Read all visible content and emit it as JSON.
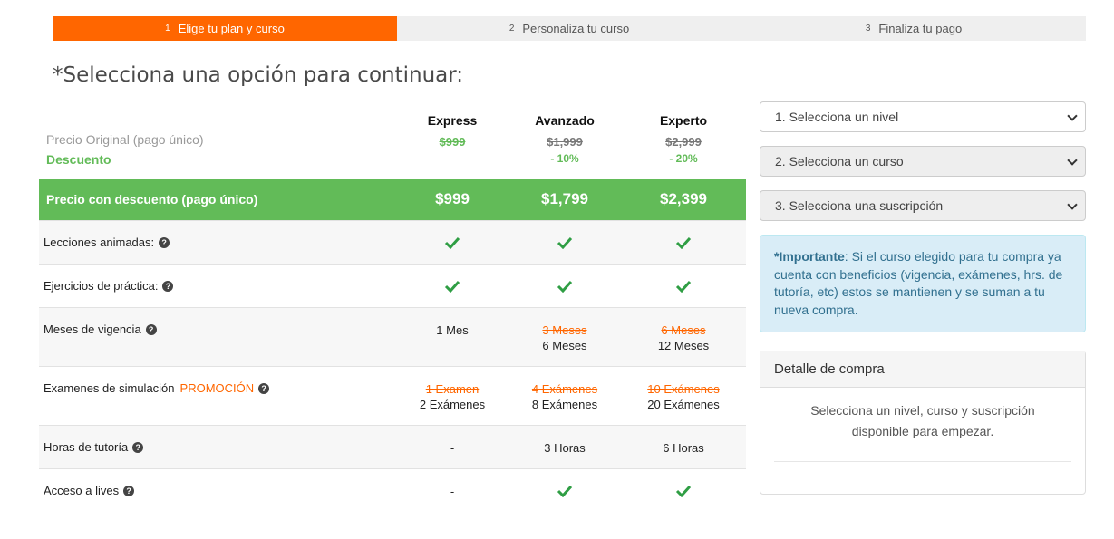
{
  "stepper": [
    {
      "num": "1",
      "label": "Elige tu plan y curso"
    },
    {
      "num": "2",
      "label": "Personaliza tu curso"
    },
    {
      "num": "3",
      "label": "Finaliza tu pago"
    }
  ],
  "page_title": "*Selecciona una opción para continuar:",
  "labels": {
    "original_price": "Precio Original (pago único)",
    "discount": "Descuento",
    "discount_price": "Precio con descuento (pago único)"
  },
  "plans": [
    {
      "name": "Express",
      "original": "$999",
      "discount": "",
      "price": "$999"
    },
    {
      "name": "Avanzado",
      "original": "$1,999",
      "discount": "- 10%",
      "price": "$1,799"
    },
    {
      "name": "Experto",
      "original": "$2,999",
      "discount": "- 20%",
      "price": "$2,399"
    }
  ],
  "features": {
    "lecciones": {
      "label": "Lecciones animadas:"
    },
    "ejercicios": {
      "label": "Ejercicios de práctica:"
    },
    "meses": {
      "label": "Meses de vigencia",
      "express": "1 Mes",
      "avanzado_old": "3 Meses",
      "avanzado": "6 Meses",
      "experto_old": "6 Meses",
      "experto": "12 Meses"
    },
    "examenes": {
      "label": "Examenes de simulación",
      "promo": "PROMOCIÓN",
      "express_old": "1 Examen",
      "express": "2 Exámenes",
      "avanzado_old": "4 Exámenes",
      "avanzado": "8 Exámenes",
      "experto_old": "10 Exámenes",
      "experto": "20 Exámenes"
    },
    "horas": {
      "label": "Horas de tutoría",
      "express": "-",
      "avanzado": "3 Horas",
      "experto": "6 Horas"
    },
    "lives": {
      "label": "Acceso a lives",
      "express": "-"
    }
  },
  "selects": {
    "nivel": "1. Selecciona un nivel",
    "curso": "2. Selecciona un curso",
    "suscripcion": "3. Selecciona una suscripción"
  },
  "info": {
    "strong": "*Importante",
    "text": ": Si el curso elegido para tu compra ya cuenta con beneficios (vigencia, exámenes, hrs. de tutoría, etc) estos se mantienen y se suman a tu nueva compra."
  },
  "detail": {
    "title": "Detalle de compra",
    "body": "Selecciona un nivel, curso y suscripción disponible para empezar."
  },
  "colors": {
    "accent": "#ff6600",
    "green": "#62bb58",
    "info_bg": "#d9edf7"
  },
  "icons": {
    "check": "check-icon",
    "help": "question-circle-icon",
    "dropdown": "chevron-down-icon"
  }
}
